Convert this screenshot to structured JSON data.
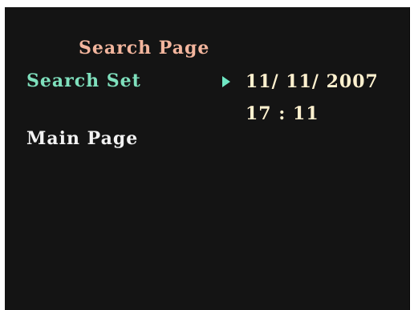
{
  "screen": {
    "title": "Search Page",
    "menu": [
      {
        "label": "Search Set",
        "state": "selected"
      },
      {
        "label": "Main Page",
        "state": "normal"
      }
    ],
    "cursor_icon": "play-triangle-icon",
    "search_set": {
      "date": "11/ 11/ 2007",
      "time": "17 : 11"
    },
    "colors": {
      "background": "#141414",
      "title": "#f2b59d",
      "selected": "#7fe0bd",
      "normal": "#f2f2f2",
      "value": "#fff1cf"
    }
  }
}
